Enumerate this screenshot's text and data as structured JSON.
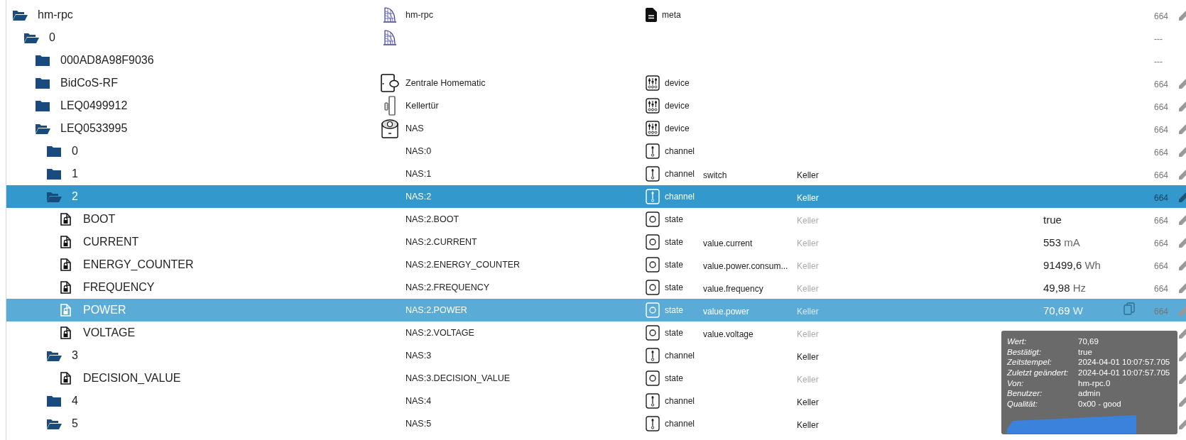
{
  "tree": [
    {
      "name": "hm-rpc",
      "kind": "folder",
      "expanded": true,
      "selected": false,
      "hovered": false,
      "image": {
        "kind": "adapter"
      },
      "label": "hm-rpc",
      "type": {
        "kind": "meta",
        "label": "meta"
      },
      "acl": "664",
      "editable": true,
      "children": [
        {
          "name": "0",
          "kind": "folder",
          "expanded": true,
          "selected": false,
          "hovered": false,
          "image": {
            "kind": "adapter"
          },
          "acl": "---",
          "editable": false,
          "children": [
            {
              "name": "000AD8A98F9036",
              "kind": "folder",
              "expanded": false,
              "selected": false,
              "hovered": false,
              "acl": "---",
              "editable": false
            },
            {
              "name": "BidCoS-RF",
              "kind": "folder",
              "expanded": false,
              "selected": false,
              "hovered": false,
              "image": {
                "kind": "ccu"
              },
              "label": "Zentrale Homematic",
              "type": {
                "kind": "device",
                "label": "device"
              },
              "acl": "664",
              "editable": true
            },
            {
              "name": "LEQ0499912",
              "kind": "folder",
              "expanded": false,
              "selected": false,
              "hovered": false,
              "image": {
                "kind": "door"
              },
              "label": "Kellertür",
              "type": {
                "kind": "device",
                "label": "device"
              },
              "acl": "664",
              "editable": true
            },
            {
              "name": "LEQ0533995",
              "kind": "folder",
              "expanded": true,
              "selected": false,
              "hovered": false,
              "image": {
                "kind": "plug"
              },
              "label": "NAS",
              "type": {
                "kind": "device",
                "label": "device"
              },
              "acl": "664",
              "editable": true,
              "children": [
                {
                  "name": "0",
                  "kind": "folder",
                  "expanded": false,
                  "selected": false,
                  "hovered": false,
                  "label": "NAS:0",
                  "type": {
                    "kind": "channel",
                    "label": "channel"
                  },
                  "acl": "664",
                  "editable": true
                },
                {
                  "name": "1",
                  "kind": "folder",
                  "expanded": false,
                  "selected": false,
                  "hovered": false,
                  "label": "NAS:1",
                  "type": {
                    "kind": "channel",
                    "label": "channel"
                  },
                  "role": "switch",
                  "room": "Keller",
                  "room_inherited": false,
                  "acl": "664",
                  "editable": true
                },
                {
                  "name": "2",
                  "kind": "folder",
                  "expanded": true,
                  "selected": true,
                  "hovered": false,
                  "label": "NAS:2",
                  "type": {
                    "kind": "channel",
                    "label": "channel"
                  },
                  "room": "Keller",
                  "room_inherited": false,
                  "acl": "664",
                  "editable": true,
                  "children": [
                    {
                      "name": "BOOT",
                      "kind": "state",
                      "selected": false,
                      "hovered": false,
                      "label": "NAS:2.BOOT",
                      "type": {
                        "kind": "state",
                        "label": "state"
                      },
                      "room": "Keller",
                      "room_inherited": true,
                      "value": "true",
                      "acl": "664",
                      "editable": true
                    },
                    {
                      "name": "CURRENT",
                      "kind": "state",
                      "selected": false,
                      "hovered": false,
                      "label": "NAS:2.CURRENT",
                      "type": {
                        "kind": "state",
                        "label": "state"
                      },
                      "role": "value.current",
                      "room": "Keller",
                      "room_inherited": true,
                      "value": "553",
                      "unit": "mA",
                      "acl": "664",
                      "editable": true
                    },
                    {
                      "name": "ENERGY_COUNTER",
                      "kind": "state",
                      "selected": false,
                      "hovered": false,
                      "label": "NAS:2.ENERGY_COUNTER",
                      "type": {
                        "kind": "state",
                        "label": "state"
                      },
                      "role": "value.power.consum...",
                      "room": "Keller",
                      "room_inherited": true,
                      "value": "91499,6",
                      "unit": "Wh",
                      "acl": "664",
                      "editable": true
                    },
                    {
                      "name": "FREQUENCY",
                      "kind": "state",
                      "selected": false,
                      "hovered": false,
                      "label": "NAS:2.FREQUENCY",
                      "type": {
                        "kind": "state",
                        "label": "state"
                      },
                      "role": "value.frequency",
                      "room": "Keller",
                      "room_inherited": true,
                      "value": "49,98",
                      "unit": "Hz",
                      "acl": "664",
                      "editable": true
                    },
                    {
                      "name": "POWER",
                      "kind": "state",
                      "selected": false,
                      "hovered": true,
                      "label": "NAS:2.POWER",
                      "type": {
                        "kind": "state",
                        "label": "state"
                      },
                      "role": "value.power",
                      "room": "Keller",
                      "room_inherited": true,
                      "value": "70,69",
                      "unit": "W",
                      "acl": "664",
                      "editable": true
                    },
                    {
                      "name": "VOLTAGE",
                      "kind": "state",
                      "selected": false,
                      "hovered": false,
                      "label": "NAS:2.VOLTAGE",
                      "type": {
                        "kind": "state",
                        "label": "state"
                      },
                      "role": "value.voltage",
                      "room": "Keller",
                      "room_inherited": true,
                      "editable": true
                    }
                  ]
                },
                {
                  "name": "3",
                  "kind": "folder",
                  "expanded": true,
                  "selected": false,
                  "hovered": false,
                  "label": "NAS:3",
                  "type": {
                    "kind": "channel",
                    "label": "channel"
                  },
                  "room": "Keller",
                  "room_inherited": false,
                  "editable": true,
                  "children": [
                    {
                      "name": "DECISION_VALUE",
                      "kind": "state",
                      "selected": false,
                      "hovered": false,
                      "label": "NAS:3.DECISION_VALUE",
                      "type": {
                        "kind": "state",
                        "label": "state"
                      },
                      "room": "Keller",
                      "room_inherited": true,
                      "editable": true
                    }
                  ]
                },
                {
                  "name": "4",
                  "kind": "folder",
                  "expanded": false,
                  "selected": false,
                  "hovered": false,
                  "label": "NAS:4",
                  "type": {
                    "kind": "channel",
                    "label": "channel"
                  },
                  "room": "Keller",
                  "room_inherited": false,
                  "editable": true
                },
                {
                  "name": "5",
                  "kind": "folder",
                  "expanded": true,
                  "selected": false,
                  "hovered": false,
                  "label": "NAS:5",
                  "type": {
                    "kind": "channel",
                    "label": "channel"
                  },
                  "room": "Keller",
                  "room_inherited": false,
                  "editable": true
                }
              ]
            }
          ]
        }
      ]
    }
  ],
  "tooltip": {
    "rows": [
      {
        "label": "Wert:",
        "value": "70,69"
      },
      {
        "label": "Bestätigt:",
        "value": "true"
      },
      {
        "label": "Zeitstempel:",
        "value": "2024-04-01 10:07:57.705"
      },
      {
        "label": "Zuletzt geändert:",
        "value": "2024-04-01 10:07:57.705"
      },
      {
        "label": "Von:",
        "value": "hm-rpc.0"
      },
      {
        "label": "Benutzer:",
        "value": "admin"
      },
      {
        "label": "Qualität:",
        "value": "0x00 - good"
      }
    ]
  }
}
